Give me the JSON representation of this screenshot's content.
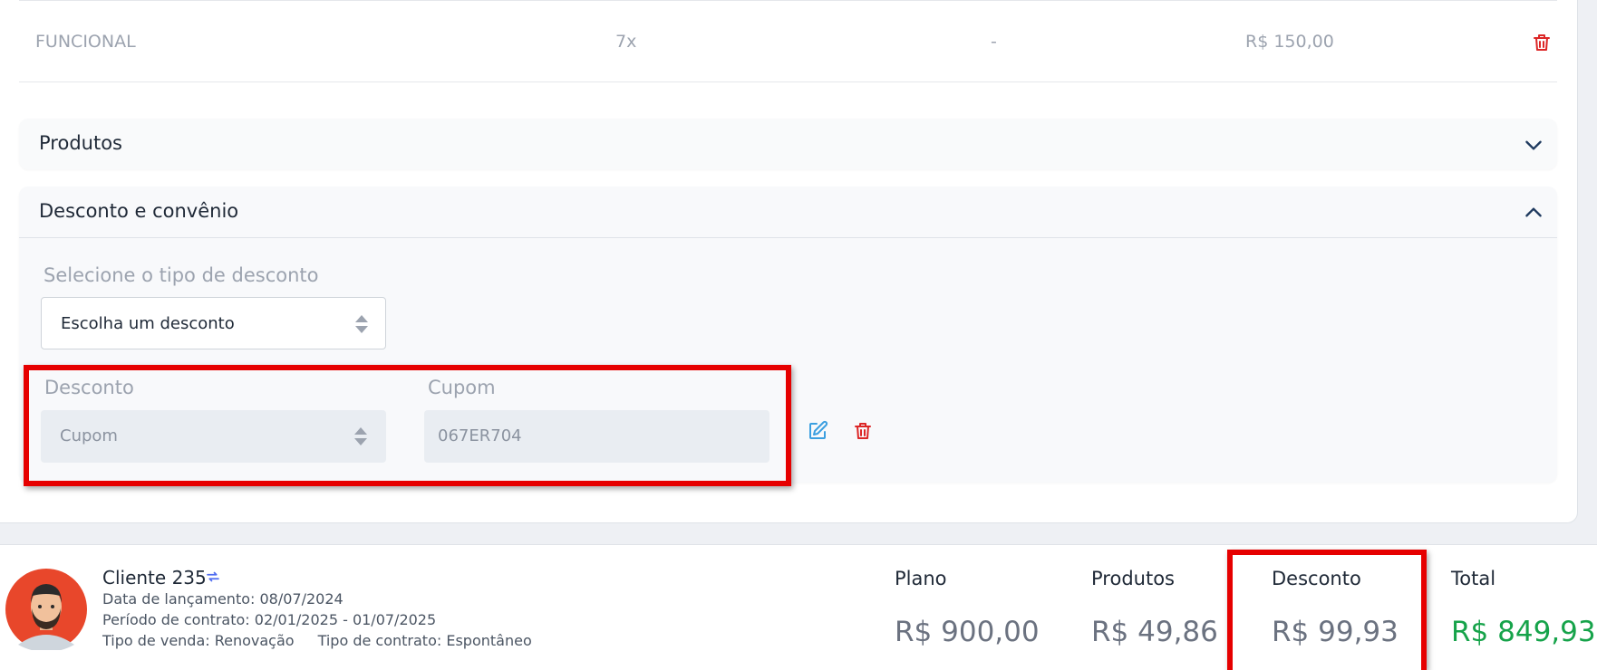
{
  "modalidade_row": {
    "name": "FUNCIONAL",
    "frequency": "7x",
    "dash": "-",
    "price": "R$ 150,00"
  },
  "accordions": {
    "produtos_title": "Produtos",
    "desconto_title": "Desconto e convênio"
  },
  "discount_form": {
    "select_label": "Selecione o tipo de desconto",
    "select_value": "Escolha um desconto",
    "desconto_label": "Desconto",
    "desconto_value": "Cupom",
    "cupom_label": "Cupom",
    "cupom_value": "067ER704"
  },
  "client": {
    "name": "Cliente 235",
    "launch_date": "Data de lançamento: 08/07/2024",
    "contract_period": "Período de contrato: 02/01/2025 - 01/07/2025",
    "sale_type": "Tipo de venda: Renovação",
    "contract_type": "Tipo de contrato: Espontâneo"
  },
  "summary": {
    "plano_label": "Plano",
    "plano_value": "R$ 900,00",
    "produtos_label": "Produtos",
    "produtos_value": "R$ 49,86",
    "desconto_label": "Desconto",
    "desconto_value": "R$ 99,93",
    "total_label": "Total",
    "total_value": "R$ 849,93"
  },
  "colors": {
    "danger": "#dc2626",
    "accent": "#3b9fe0",
    "total_green": "#16a34a",
    "highlight": "#e60000"
  },
  "icons": [
    "trash-icon",
    "chevron-down-icon",
    "chevron-up-icon",
    "select-arrows-icon",
    "edit-icon",
    "sync-icon",
    "avatar"
  ]
}
